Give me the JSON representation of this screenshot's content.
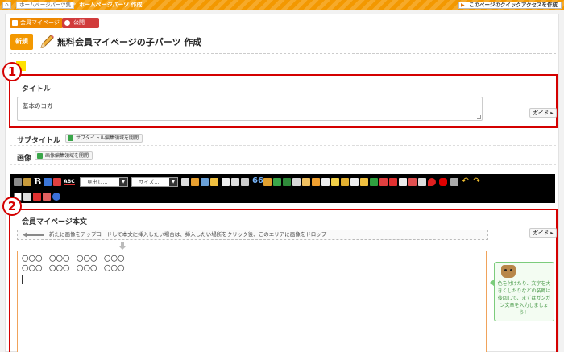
{
  "topbar": {
    "breadcrumb_1": "ホームページパーツ集",
    "breadcrumb_sep": "»",
    "breadcrumb_2": "ホームページパーツ 作成",
    "quick_access": "このページのクイックアクセスを作成"
  },
  "status": {
    "member_chip": "会員マイページ",
    "public_chip": "公開"
  },
  "header": {
    "new_badge": "新規",
    "title": "無料会員マイページの子パーツ 作成"
  },
  "section1": {
    "number": "1",
    "label": "タイトル",
    "value": "基本のヨガ",
    "guide_label": "ガイド ▸"
  },
  "subtitle": {
    "label": "サブタイトル",
    "button": "サブタイトル編集領域を開閉"
  },
  "image": {
    "label": "画像",
    "button": "画像編集領域を開閉"
  },
  "toolbar": {
    "heading_select": "見出し...",
    "size_select": "サイズ...",
    "dropdown_arrow": "▼",
    "abc_glyph": "ABC",
    "bold_glyph": "B",
    "quote_glyph": "66"
  },
  "section2": {
    "number": "2",
    "label": "会員マイページ本文",
    "drop_hint": "新たに画像をアップロードして本文に挿入したい場合は、挿入したい場所をクリック後、このエリアに画像をドロップ",
    "guide_label": "ガイド ▸",
    "editor_line_1": "〇〇〇　〇〇〇　〇〇〇　〇〇〇",
    "editor_line_2": "〇〇〇　〇〇〇　〇〇〇　〇〇〇",
    "tip": "色を付けたり、文字を大きくしたりなどの装飾は後回しで、まずはガンガン文章を入力しましょう！"
  }
}
